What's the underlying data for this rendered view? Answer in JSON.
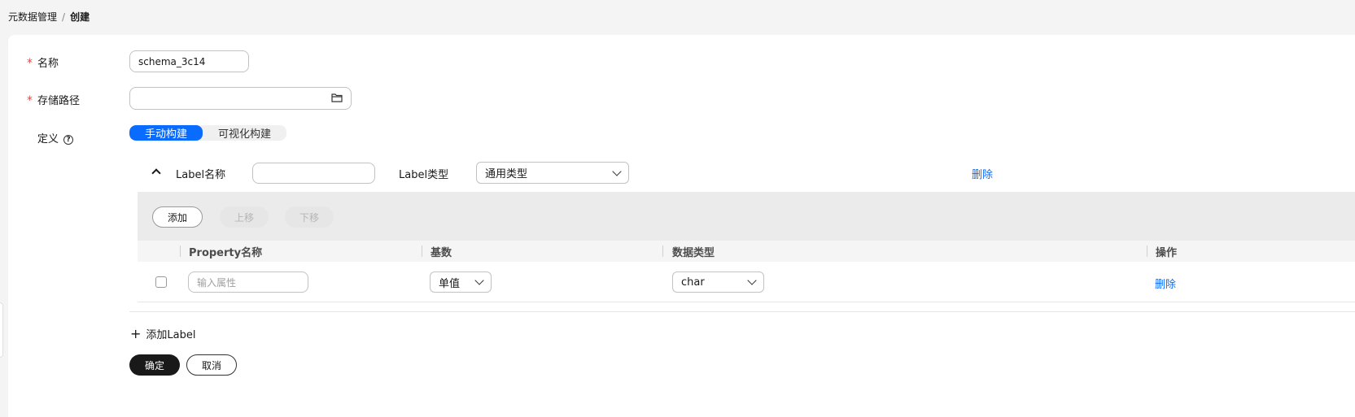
{
  "breadcrumb": {
    "parent": "元数据管理",
    "separator": "/",
    "current": "创建"
  },
  "form": {
    "name_label": "名称",
    "name_value": "schema_3c14",
    "path_label": "存储路径",
    "path_value": "",
    "definition_label": "定义",
    "help_icon": "question-circle-icon",
    "folder_icon": "folder-icon",
    "required_mark": "*"
  },
  "build_mode": {
    "options": [
      "手动构建",
      "可视化构建"
    ],
    "active": "手动构建"
  },
  "label_block": {
    "name_label": "Label名称",
    "name_value": "",
    "type_label": "Label类型",
    "type_value": "通用类型",
    "delete_label": "删除"
  },
  "toolbar": {
    "add_label": "添加",
    "up_label": "上移",
    "down_label": "下移"
  },
  "table": {
    "headers": [
      "Property名称",
      "基数",
      "数据类型",
      "操作"
    ],
    "rows": [
      {
        "property_placeholder": "输入属性",
        "cardinality": "单值",
        "data_type": "char",
        "action": "删除"
      }
    ]
  },
  "add_label_link": "添加Label",
  "footer": {
    "confirm_label": "确定",
    "cancel_label": "取消"
  },
  "colors": {
    "accent": "#0a6cff",
    "required": "#e54545",
    "primary_button": "#191919"
  }
}
